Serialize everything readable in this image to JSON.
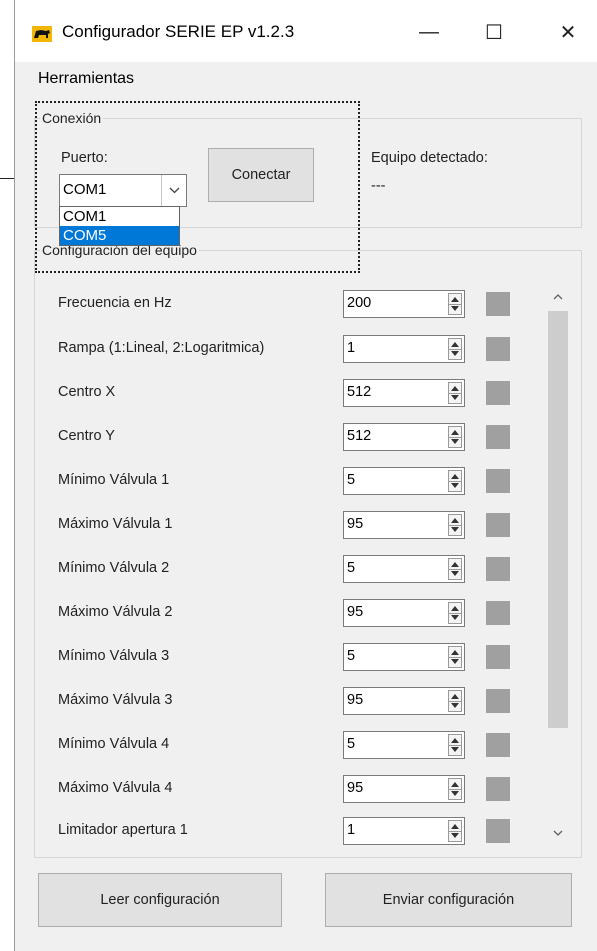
{
  "window": {
    "title": "Configurador SERIE EP v1.2.3",
    "controls": {
      "minimize": "—",
      "maximize": "☐",
      "close": "✕"
    }
  },
  "menu": {
    "items": [
      "Herramientas"
    ]
  },
  "connection": {
    "group_label": "Conexión",
    "port_label": "Puerto:",
    "port_value": "COM1",
    "port_options": [
      "COM1",
      "COM5"
    ],
    "highlighted_option": "COM5",
    "connect_button": "Conectar",
    "detected_label": "Equipo detectado:",
    "detected_value": "---"
  },
  "config": {
    "group_label": "Configuración del equipo",
    "rows": [
      {
        "label": "Frecuencia en Hz",
        "value": "200"
      },
      {
        "label": "Rampa (1:Lineal, 2:Logaritmica)",
        "value": "1"
      },
      {
        "label": "Centro X",
        "value": "512"
      },
      {
        "label": "Centro Y",
        "value": "512"
      },
      {
        "label": "Mínimo Válvula 1",
        "value": "5"
      },
      {
        "label": "Máximo Válvula 1",
        "value": "95"
      },
      {
        "label": "Mínimo Válvula 2",
        "value": "5"
      },
      {
        "label": "Máximo Válvula 2",
        "value": "95"
      },
      {
        "label": "Mínimo Válvula 3",
        "value": "5"
      },
      {
        "label": "Máximo Válvula 3",
        "value": "95"
      },
      {
        "label": "Mínimo Válvula 4",
        "value": "5"
      },
      {
        "label": "Máximo Válvula 4",
        "value": "95"
      },
      {
        "label": "Limitador apertura 1",
        "value": "1"
      }
    ]
  },
  "buttons": {
    "read": "Leer configuración",
    "send": "Enviar configuración"
  },
  "colors": {
    "selection": "#0078d7",
    "swatch": "#a0a0a0",
    "window_bg": "#f0f0f0"
  }
}
